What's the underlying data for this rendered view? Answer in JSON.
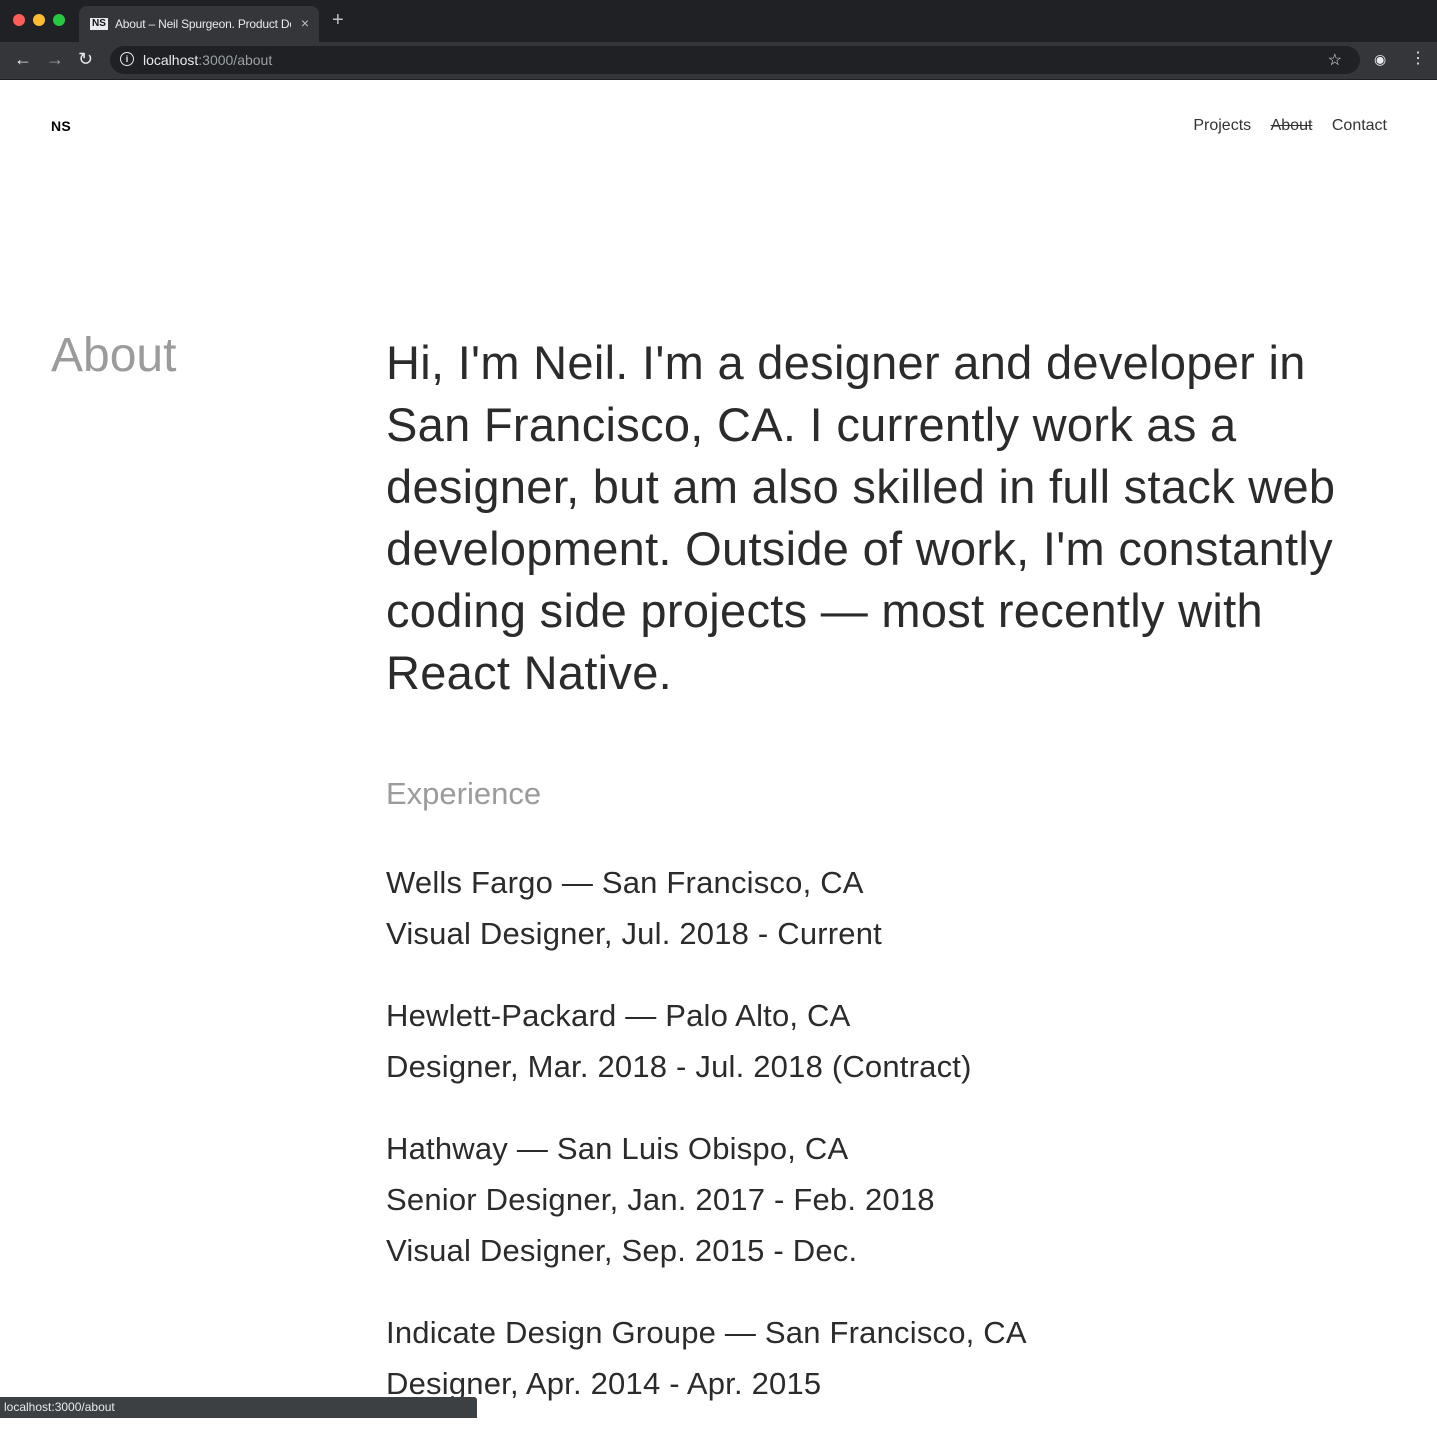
{
  "browser": {
    "tab": {
      "favicon": "NS",
      "title": "About – Neil Spurgeon. Product Designer",
      "close": "×"
    },
    "new_tab": "+",
    "url": {
      "host": "localhost",
      "rest": ":3000/about"
    },
    "status_text": "localhost:3000/about"
  },
  "site": {
    "logo": "NS",
    "nav": [
      "Projects",
      "About",
      "Contact"
    ],
    "active_nav": "About"
  },
  "about": {
    "heading": "About",
    "intro": "Hi, I'm Neil. I'm a designer and developer in San Francisco, CA. I currently work as a designer, but am also skilled in full stack web development. Outside of work, I'm constantly coding side projects — most recently with React Native.",
    "experience_heading": "Experience",
    "experience": [
      {
        "lines": [
          "Wells Fargo — San Francisco, CA",
          "Visual Designer, Jul. 2018 - Current"
        ]
      },
      {
        "lines": [
          "Hewlett-Packard — Palo Alto, CA",
          "Designer, Mar. 2018 - Jul. 2018 (Contract)"
        ]
      },
      {
        "lines": [
          "Hathway — San Luis Obispo, CA",
          "Senior Designer, Jan. 2017 - Feb. 2018",
          "Visual Designer, Sep. 2015 - Dec."
        ]
      },
      {
        "lines": [
          "Indicate Design Groupe — San Francisco, CA",
          "Designer, Apr. 2014 - Apr. 2015"
        ]
      }
    ]
  },
  "icons": {
    "back": "back-arrow-icon",
    "forward": "forward-arrow-icon",
    "reload": "reload-icon",
    "info": "info-icon",
    "bookmark": "star-icon",
    "incognito": "incognito-icon",
    "menu": "kebab-menu-icon"
  }
}
